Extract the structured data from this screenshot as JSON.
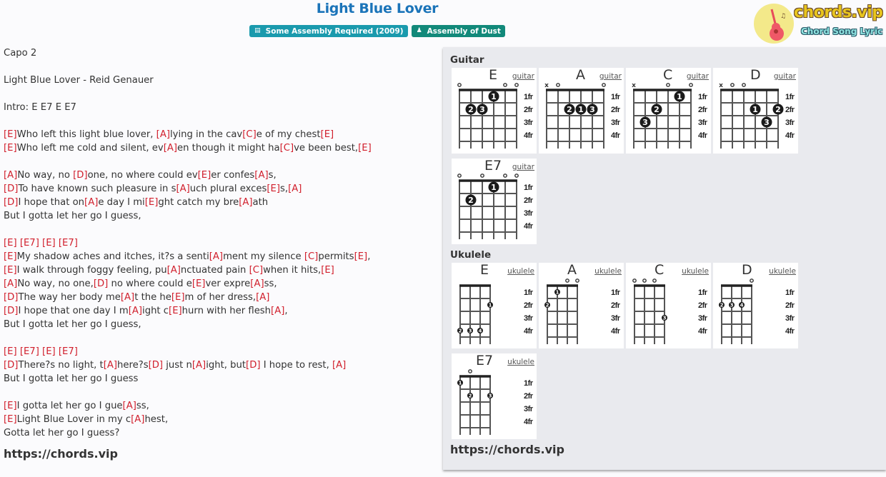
{
  "header": {
    "title": "Light Blue Lover",
    "album_badge": {
      "icon": "book-icon",
      "label": "Some Assembly Required (2009)"
    },
    "artist_badge": {
      "icon": "user-icon",
      "label": "Assembly of Dust"
    }
  },
  "logo": {
    "brand": "chords.vip",
    "tagline": "Chord Song Lyric"
  },
  "colors": {
    "title": "#1b74b9",
    "chord": "#d11f2c",
    "album_badge": "#1a9aad",
    "artist_badge": "#12897a"
  },
  "lyrics": [
    "Capo 2",
    "",
    "Light Blue Lover - Reid Genauer",
    "",
    "Intro: E E7 E E7",
    "",
    "[E]Who left this light blue lover, [A]lying in the cav[C]e of my chest[E]",
    "[E]Who left me cold and silent, ev[A]en though it might ha[C]ve been best,[E]",
    "",
    "[A]No way, no [D]one, no where could ev[E]er confes[A]s,",
    "[D]To have known such pleasure in s[A]uch plural exces[E]s,[A]",
    "[D]I hope that on[A]e day I mi[E]ght catch my bre[A]ath",
    "But I gotta let her go I guess,",
    "",
    "[E] [E7] [E] [E7]",
    "[E]My shadow aches and itches, it?s a senti[A]ment my silence [C]permits[E],",
    "[E]I walk through foggy feeling, pu[A]nctuated pain [C]when it hits,[E]",
    "[A]No way, no one,[D] no where could e[E]ver expre[A]ss,",
    "[D]The way her body me[A]t the he[E]m of her dress,[A]",
    "[D]I hope that one day I m[A]ight c[E]hurn with her flesh[A],",
    "But I gotta let her go I guess,",
    "",
    "[E] [E7] [E] [E7]",
    "[D]There?s no light, t[A]here?s[D] just n[A]ight, but[D] I hope to rest, [A]",
    "But I gotta let her go I guess",
    "",
    "[E]I gotta let her go I gue[A]ss,",
    "[E]Light Blue Lover in my c[A]hest,",
    "Gotta let her go I guess?"
  ],
  "lyrics_footer": "https://chords.vip",
  "chord_panel": {
    "guitar_heading": "Guitar",
    "ukulele_heading": "Ukulele",
    "footer": "https://chords.vip",
    "fret_labels": [
      "1fr",
      "2fr",
      "3fr",
      "4fr"
    ],
    "guitar": [
      {
        "name": "E",
        "instrument": "guitar",
        "markers": [
          "o",
          "",
          "",
          "",
          "o",
          "o"
        ],
        "fingers": [
          {
            "string": 4,
            "fret": 1,
            "finger": "1"
          },
          {
            "string": 2,
            "fret": 2,
            "finger": "2"
          },
          {
            "string": 3,
            "fret": 2,
            "finger": "3"
          }
        ]
      },
      {
        "name": "A",
        "instrument": "guitar",
        "markers": [
          "x",
          "o",
          "",
          "",
          "",
          "o"
        ],
        "fingers": [
          {
            "string": 3,
            "fret": 2,
            "finger": "2"
          },
          {
            "string": 4,
            "fret": 2,
            "finger": "1"
          },
          {
            "string": 5,
            "fret": 2,
            "finger": "3"
          }
        ]
      },
      {
        "name": "C",
        "instrument": "guitar",
        "markers": [
          "x",
          "",
          "",
          "o",
          "",
          "o"
        ],
        "fingers": [
          {
            "string": 5,
            "fret": 1,
            "finger": "1"
          },
          {
            "string": 3,
            "fret": 2,
            "finger": "2"
          },
          {
            "string": 2,
            "fret": 3,
            "finger": "3"
          }
        ]
      },
      {
        "name": "D",
        "instrument": "guitar",
        "markers": [
          "x",
          "o",
          "o",
          "",
          "",
          ""
        ],
        "fingers": [
          {
            "string": 4,
            "fret": 2,
            "finger": "1"
          },
          {
            "string": 6,
            "fret": 2,
            "finger": "2"
          },
          {
            "string": 5,
            "fret": 3,
            "finger": "3"
          }
        ]
      },
      {
        "name": "E7",
        "instrument": "guitar",
        "markers": [
          "o",
          "",
          "o",
          "",
          "o",
          "o"
        ],
        "fingers": [
          {
            "string": 4,
            "fret": 1,
            "finger": "1"
          },
          {
            "string": 2,
            "fret": 2,
            "finger": "2"
          }
        ]
      }
    ],
    "ukulele": [
      {
        "name": "E",
        "instrument": "ukulele",
        "markers": [
          "",
          "",
          "",
          ""
        ],
        "fingers": [
          {
            "string": 4,
            "fret": 2,
            "finger": "1"
          },
          {
            "string": 1,
            "fret": 4,
            "finger": "2"
          },
          {
            "string": 2,
            "fret": 4,
            "finger": "3"
          },
          {
            "string": 3,
            "fret": 4,
            "finger": "4"
          }
        ]
      },
      {
        "name": "A",
        "instrument": "ukulele",
        "markers": [
          "",
          "",
          "o",
          "o"
        ],
        "fingers": [
          {
            "string": 2,
            "fret": 1,
            "finger": "1"
          },
          {
            "string": 1,
            "fret": 2,
            "finger": "2"
          }
        ]
      },
      {
        "name": "C",
        "instrument": "ukulele",
        "markers": [
          "o",
          "o",
          "o",
          ""
        ],
        "fingers": [
          {
            "string": 4,
            "fret": 3,
            "finger": "3"
          }
        ]
      },
      {
        "name": "D",
        "instrument": "ukulele",
        "markers": [
          "",
          "",
          "",
          "o"
        ],
        "fingers": [
          {
            "string": 1,
            "fret": 2,
            "finger": "2"
          },
          {
            "string": 2,
            "fret": 2,
            "finger": "3"
          },
          {
            "string": 3,
            "fret": 2,
            "finger": "4"
          }
        ]
      },
      {
        "name": "E7",
        "instrument": "ukulele",
        "markers": [
          "",
          "o",
          "",
          ""
        ],
        "fingers": [
          {
            "string": 1,
            "fret": 1,
            "finger": "1"
          },
          {
            "string": 2,
            "fret": 2,
            "finger": "2"
          },
          {
            "string": 4,
            "fret": 2,
            "finger": "3"
          }
        ]
      }
    ]
  }
}
